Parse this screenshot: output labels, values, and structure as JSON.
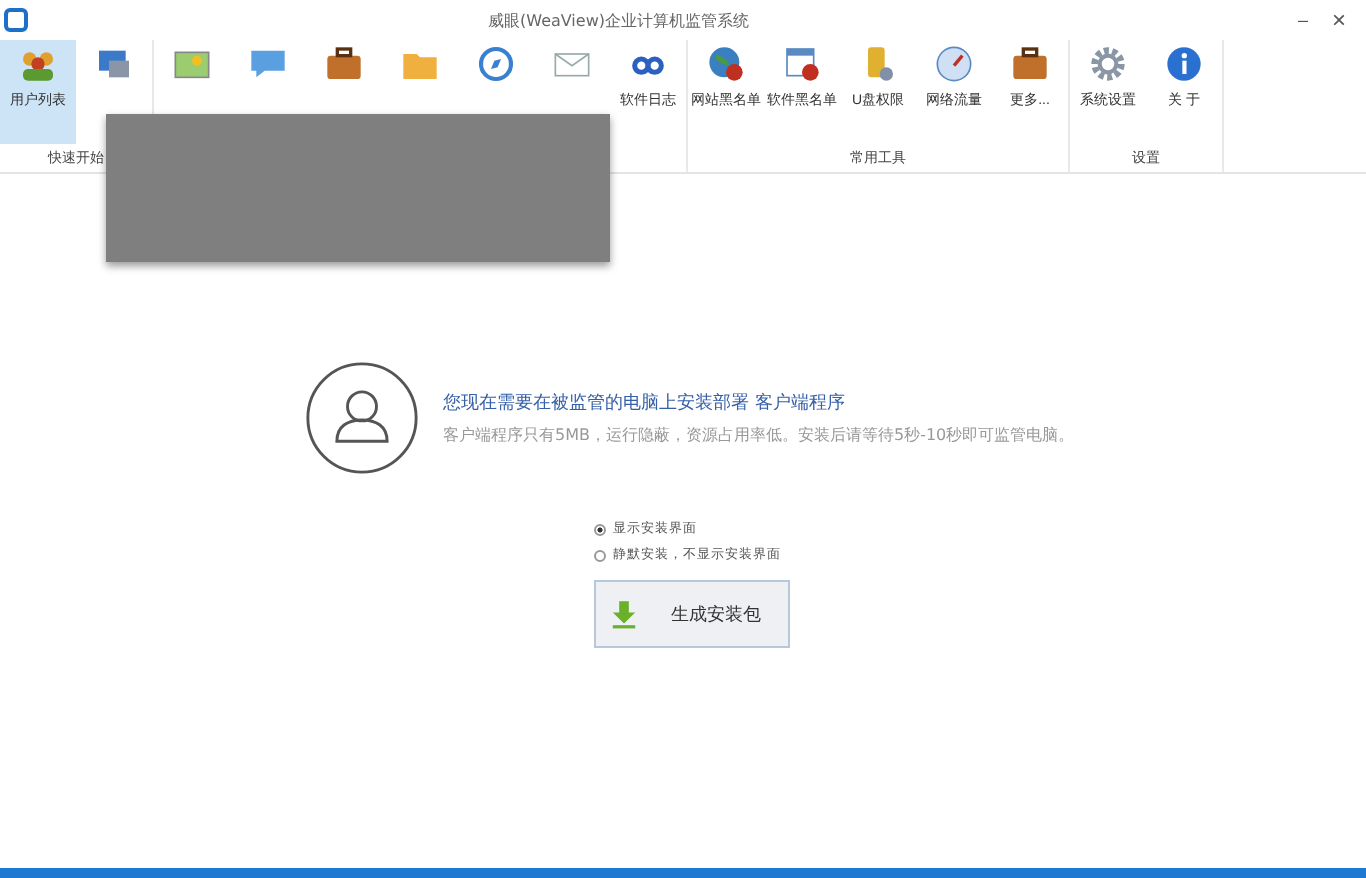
{
  "window": {
    "title": "威眼(WeaView)企业计算机监管系统",
    "buttons": [
      {
        "kind": "minimize",
        "label": "–"
      },
      {
        "kind": "close",
        "label": "×"
      }
    ]
  },
  "ribbon": {
    "groups": [
      {
        "label": "快速开始",
        "items": [
          {
            "label": "用户列表",
            "kind": "users",
            "selected": true
          },
          {
            "kind": "screens",
            "selected": false
          }
        ]
      },
      {
        "items": [
          {
            "kind": "picture",
            "selected": false
          },
          {
            "kind": "chat",
            "selected": false
          },
          {
            "kind": "case",
            "selected": false
          },
          {
            "kind": "folder",
            "selected": false
          },
          {
            "kind": "compass",
            "selected": false
          },
          {
            "kind": "mail",
            "selected": false
          },
          {
            "label": "软件日志",
            "kind": "link",
            "selected": false
          }
        ]
      },
      {
        "label": "常用工具",
        "items": [
          {
            "label": "网站黑名单",
            "kind": "globe",
            "selected": false
          },
          {
            "label": "软件黑名单",
            "kind": "window",
            "selected": false
          },
          {
            "label": "U盘权限",
            "kind": "usb",
            "selected": false
          },
          {
            "label": "网络流量",
            "kind": "gauge",
            "selected": false
          },
          {
            "label": "更多...",
            "kind": "case",
            "selected": false
          }
        ]
      },
      {
        "label": "设置",
        "items": [
          {
            "label": "系统设置",
            "kind": "gear",
            "selected": false
          },
          {
            "label": "关 于",
            "kind": "info",
            "selected": false
          }
        ]
      }
    ]
  },
  "install": {
    "heading": "您现在需要在被监管的电脑上安装部署 客户端程序",
    "description": "客户端程序只有5MB，运行隐蔽，资源占用率低。安装后请等待5秒-10秒即可监管电脑。",
    "options": [
      {
        "label": "显示安装界面",
        "selected": true
      },
      {
        "label": "静默安装，不显示安装界面",
        "selected": false
      }
    ],
    "button": "生成安装包"
  }
}
